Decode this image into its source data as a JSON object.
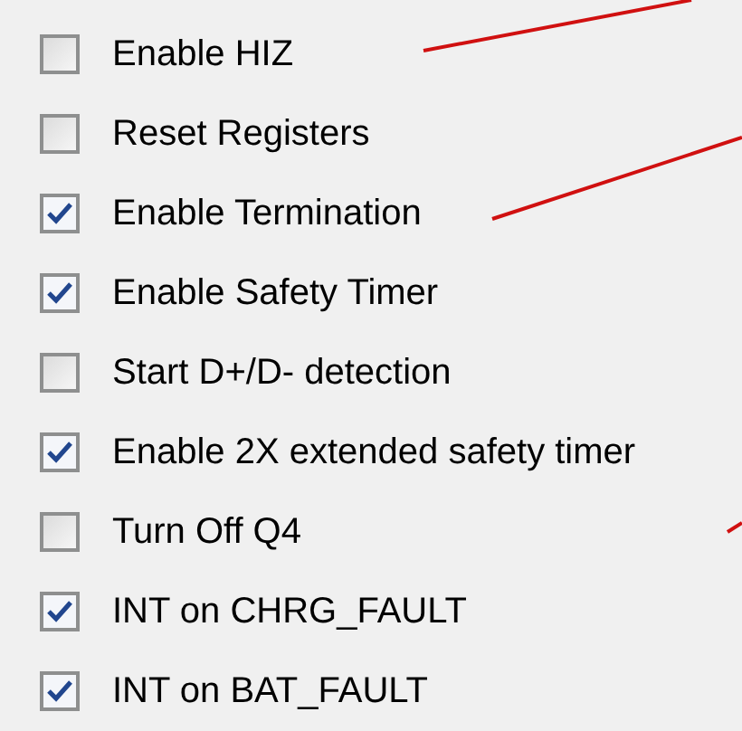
{
  "options": [
    {
      "label": "Enable HIZ",
      "checked": false
    },
    {
      "label": "Reset Registers",
      "checked": false
    },
    {
      "label": "Enable Termination",
      "checked": true
    },
    {
      "label": "Enable Safety Timer",
      "checked": true
    },
    {
      "label": "Start D+/D- detection",
      "checked": false
    },
    {
      "label": "Enable 2X extended safety timer",
      "checked": true
    },
    {
      "label": "Turn Off Q4",
      "checked": false
    },
    {
      "label": "INT on CHRG_FAULT",
      "checked": true
    },
    {
      "label": "INT on BAT_FAULT",
      "checked": true
    }
  ]
}
